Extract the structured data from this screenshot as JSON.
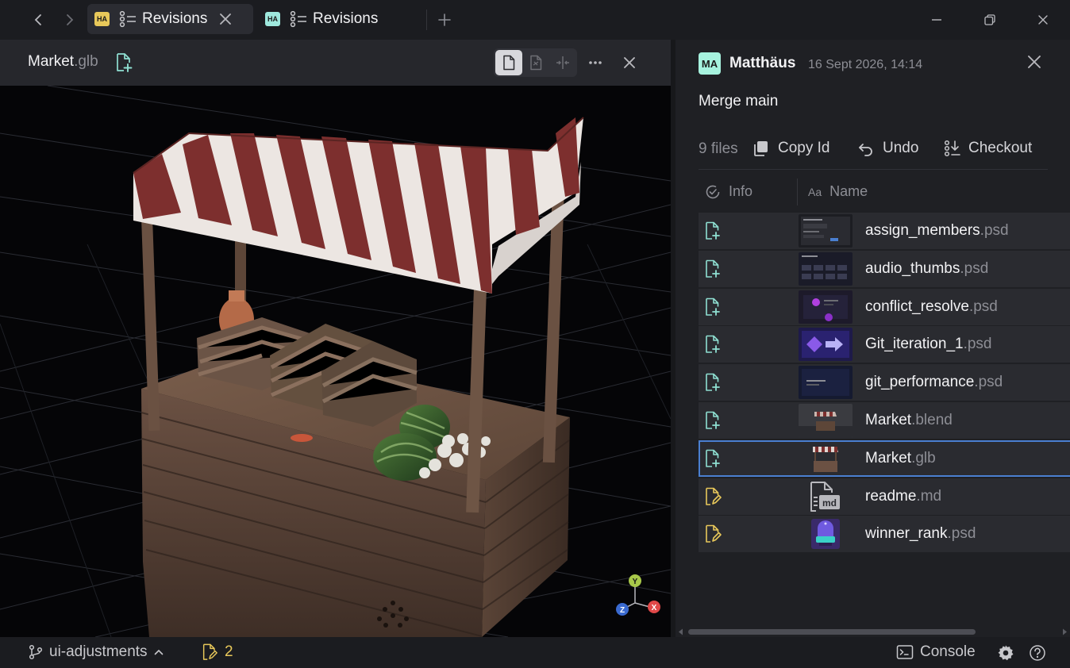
{
  "tabs": [
    {
      "badge": "HA",
      "badge_color": "#e8c85a",
      "title": "Revisions",
      "active": true
    },
    {
      "badge": "HA",
      "badge_color": "#9ee8dd",
      "title": "Revisions",
      "active": false
    }
  ],
  "viewer": {
    "file_name": "Market",
    "file_ext": ".glb",
    "gizmo_axes": {
      "y": "Y",
      "x": "X",
      "z": "Z"
    }
  },
  "commit": {
    "avatar": "MA",
    "author": "Matthäus",
    "timestamp": "16 Sept 2026, 14:14",
    "message": "Merge main",
    "files_count": "9 files",
    "actions": {
      "copy_id": "Copy Id",
      "undo": "Undo",
      "checkout": "Checkout"
    }
  },
  "columns": {
    "info": "Info",
    "name_icon": "Aa",
    "name": "Name"
  },
  "files": [
    {
      "name": "assign_members",
      "ext": ".psd",
      "status": "added",
      "thumb": "ui-dark"
    },
    {
      "name": "audio_thumbs",
      "ext": ".psd",
      "status": "added",
      "thumb": "ui-grid"
    },
    {
      "name": "conflict_resolve",
      "ext": ".psd",
      "status": "added",
      "thumb": "ui-purple"
    },
    {
      "name": "Git_iteration_1",
      "ext": ".psd",
      "status": "added",
      "thumb": "git-arrow"
    },
    {
      "name": "git_performance",
      "ext": ".psd",
      "status": "added",
      "thumb": "ui-navy"
    },
    {
      "name": "Market",
      "ext": ".blend",
      "status": "added",
      "thumb": "market-scene"
    },
    {
      "name": "Market",
      "ext": ".glb",
      "status": "added",
      "thumb": "market-stall",
      "selected": true
    },
    {
      "name": "readme",
      "ext": ".md",
      "status": "modified",
      "thumb": "md-file"
    },
    {
      "name": "winner_rank",
      "ext": ".psd",
      "status": "modified",
      "thumb": "trophy"
    }
  ],
  "status_bar": {
    "branch": "ui-adjustments",
    "changes": "2",
    "console": "Console"
  },
  "colors": {
    "added_icon": "#8fe0d2",
    "modified_icon": "#e8c85a",
    "selection": "#4a7fd0"
  }
}
